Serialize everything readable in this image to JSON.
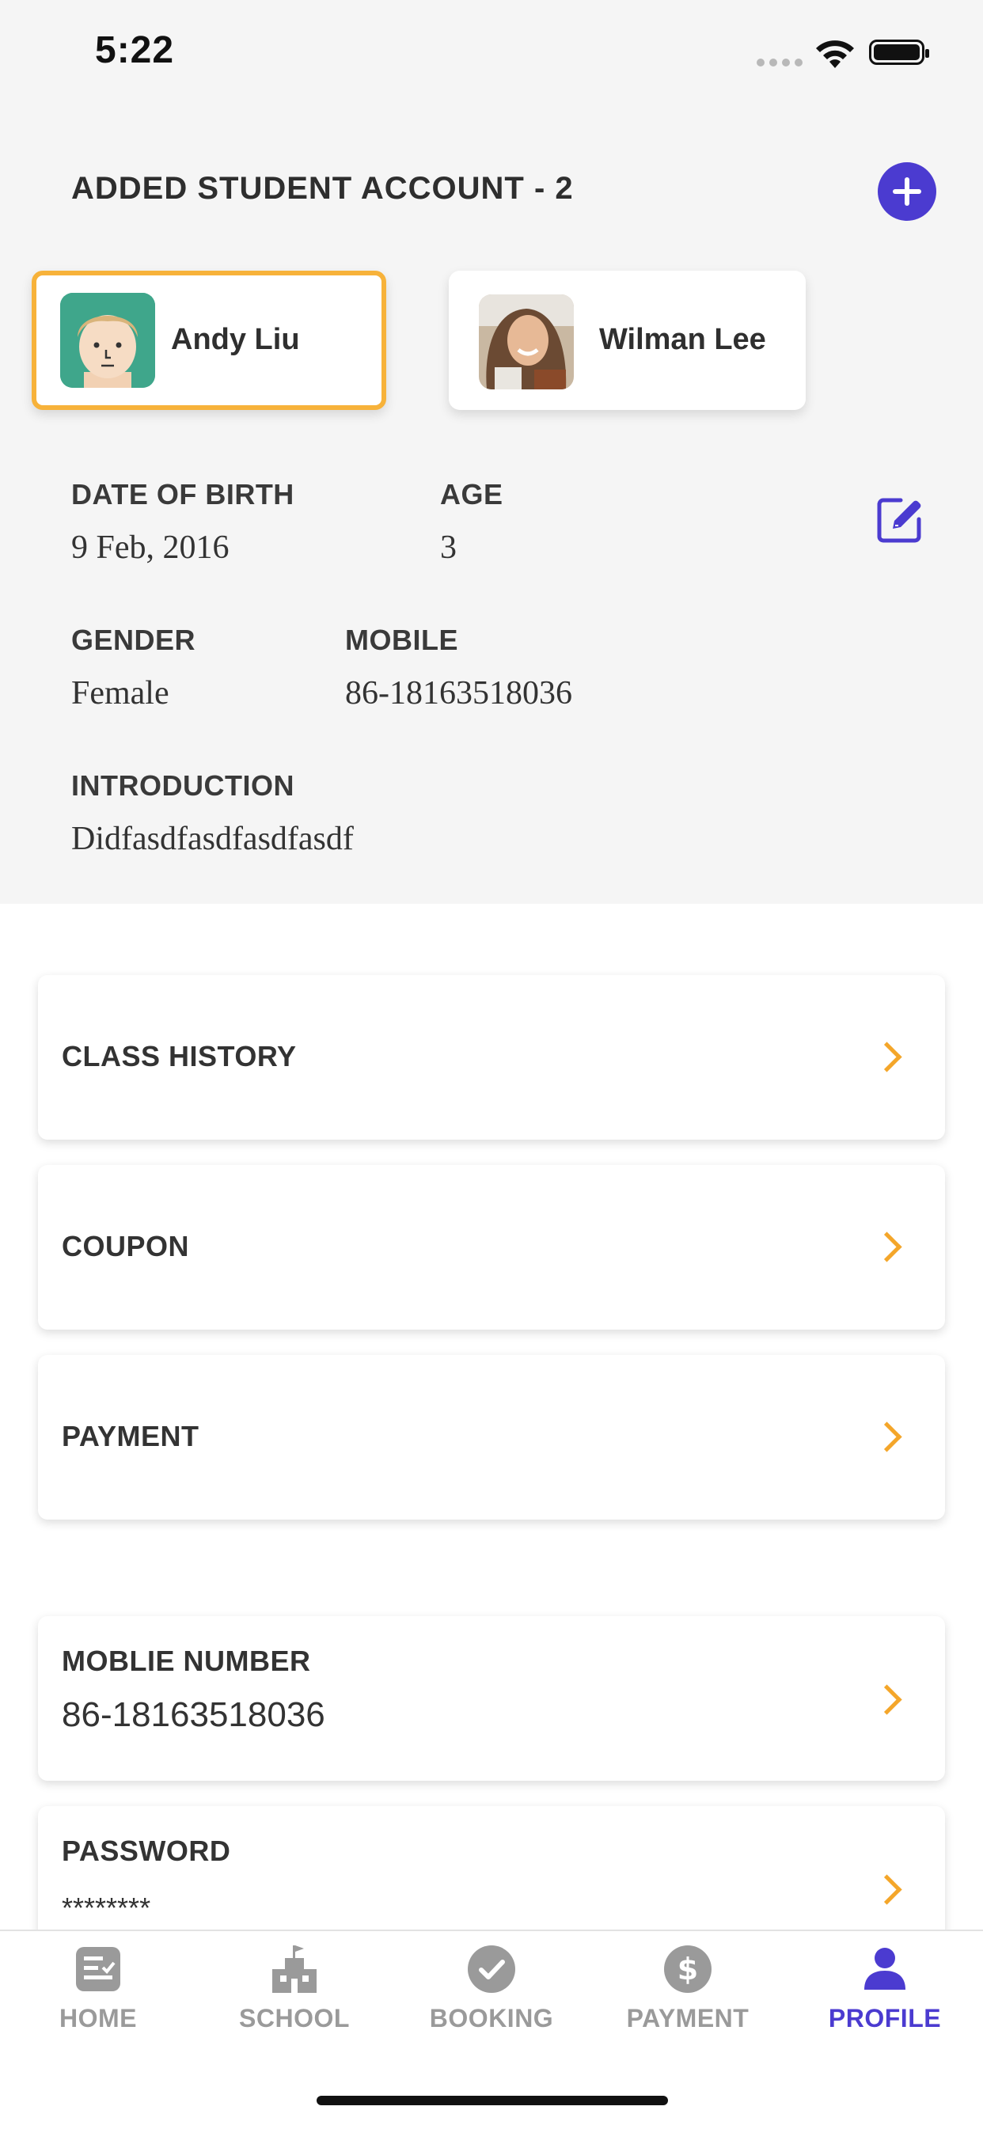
{
  "status_bar": {
    "time": "5:22"
  },
  "header": {
    "title": "ADDED STUDENT ACCOUNT - 2"
  },
  "students": [
    {
      "name": "Andy Liu",
      "selected": true
    },
    {
      "name": "Wilman Lee",
      "selected": false
    }
  ],
  "details": {
    "dob_label": "DATE OF BIRTH",
    "dob_value": "9 Feb,  2016",
    "age_label": "AGE",
    "age_value": "3",
    "gender_label": "GENDER",
    "gender_value": "Female",
    "mobile_label": "MOBILE",
    "mobile_value": "86-18163518036",
    "intro_label": "INTRODUCTION",
    "intro_value": "Didfasdfasdfasdfasdf"
  },
  "menu": {
    "class_history": "CLASS HISTORY",
    "coupon": "COUPON",
    "payment": "PAYMENT",
    "mobile_number_label": "MOBLIE NUMBER",
    "mobile_number_value": "86-18163518036",
    "password_label": "PASSWORD",
    "password_value": "********"
  },
  "tabs": {
    "home": "HOME",
    "school": "SCHOOL",
    "booking": "BOOKING",
    "payment": "PAYMENT",
    "profile": "PROFILE"
  },
  "colors": {
    "accent": "#4b3bd0",
    "selected_border": "#f7b23a",
    "chevron": "#f4a62a"
  }
}
